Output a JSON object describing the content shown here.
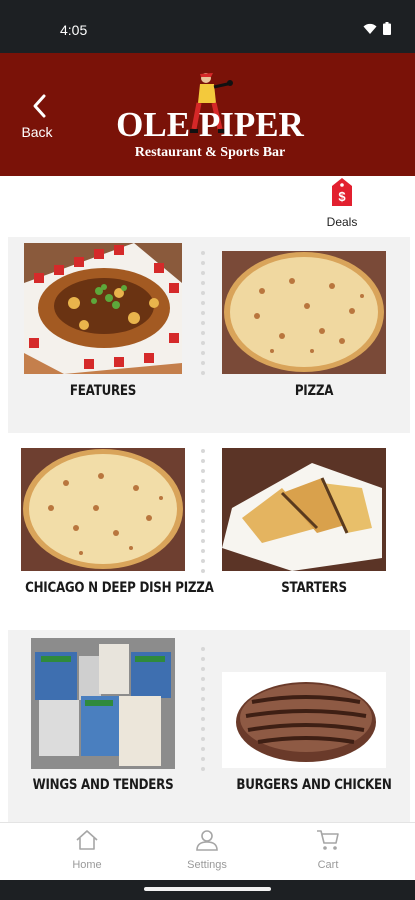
{
  "status_bar": {
    "time": "4:05"
  },
  "header": {
    "back_label": "Back",
    "logo_title": "OLE PIPER",
    "logo_subtitle": "Restaurant & Sports Bar"
  },
  "deals": {
    "label": "Deals",
    "icon": "price-tag-icon",
    "badge": "$"
  },
  "categories": [
    {
      "label": "FEATURES"
    },
    {
      "label": "PIZZA"
    },
    {
      "label": "CHICAGO N DEEP DISH PIZZA"
    },
    {
      "label": "STARTERS"
    },
    {
      "label": "WINGS AND TENDERS"
    },
    {
      "label": "BURGERS AND CHICKEN"
    }
  ],
  "bottom_nav": [
    {
      "label": "Home",
      "icon": "home-icon"
    },
    {
      "label": "Settings",
      "icon": "user-icon"
    },
    {
      "label": "Cart",
      "icon": "cart-icon"
    }
  ],
  "colors": {
    "header_bg": "#7a1208",
    "deals_accent": "#e2202f",
    "status_bar": "#1d2023"
  }
}
